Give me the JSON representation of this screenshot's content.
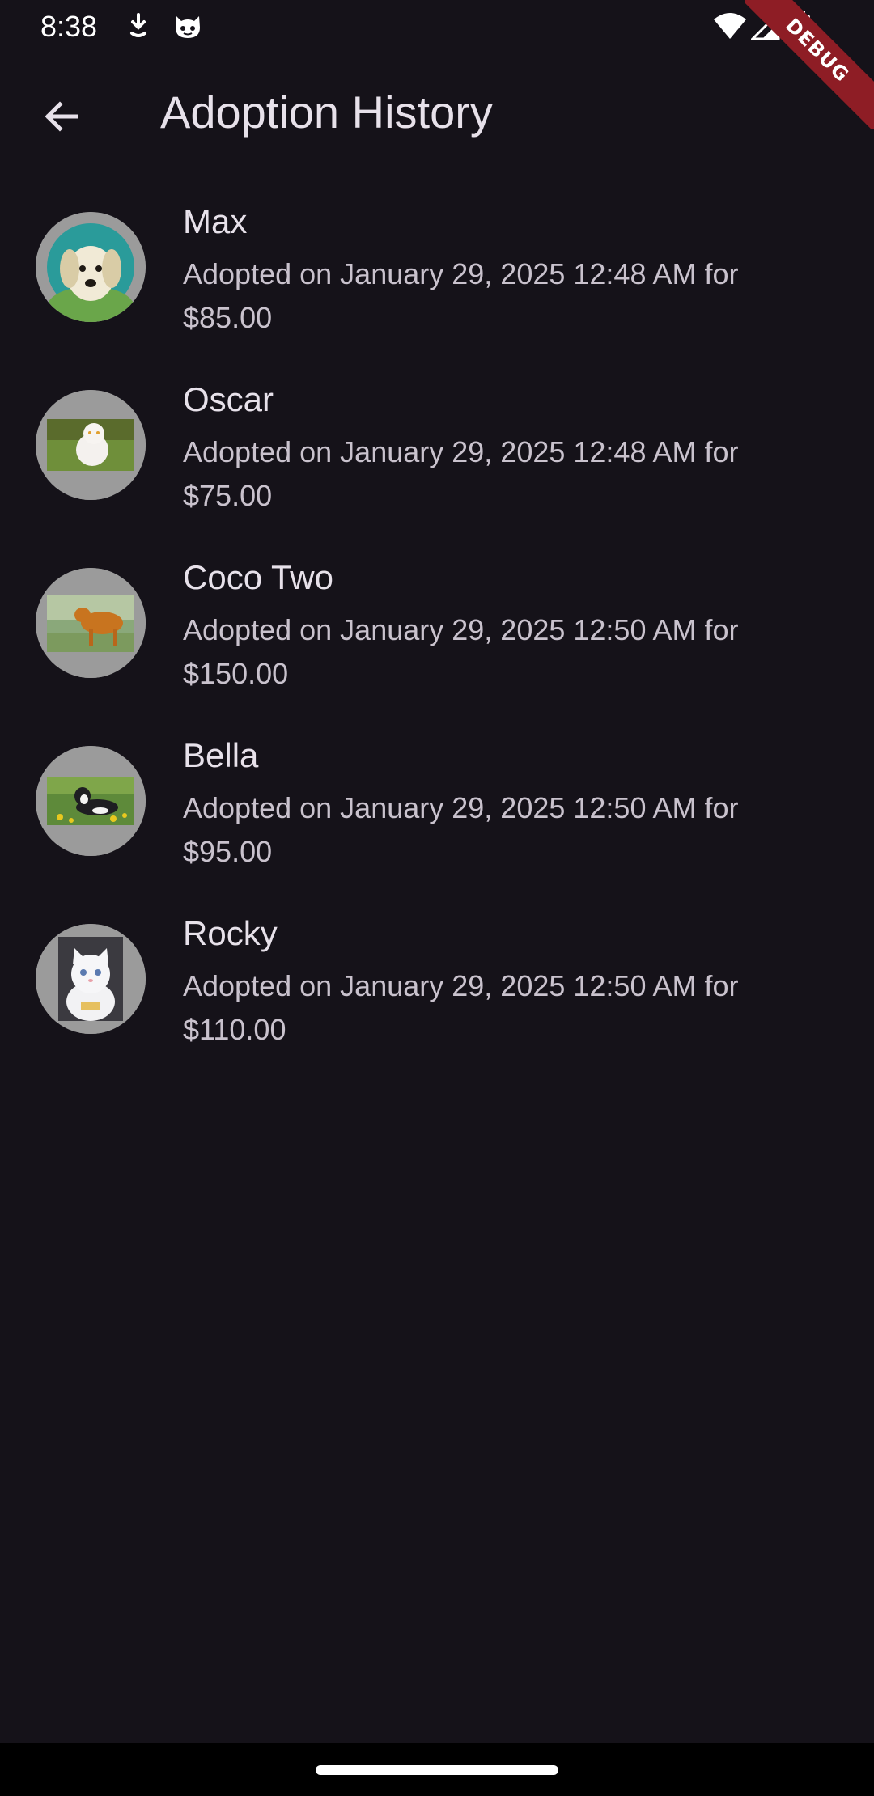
{
  "status_bar": {
    "time": "8:38",
    "icons": [
      "download-icon",
      "cat-face-icon",
      "wifi-icon",
      "signal-icon",
      "battery-icon"
    ]
  },
  "debug_banner": {
    "label": "DEBUG",
    "color": "#8e1d25"
  },
  "app_bar": {
    "back_icon": "arrow-left-icon",
    "title": "Adoption History"
  },
  "adoptions": [
    {
      "name": "Max",
      "detail": "Adopted on January 29, 2025 12:48 AM for $85.00",
      "photo": "puppy-photo"
    },
    {
      "name": "Oscar",
      "detail": "Adopted on January 29, 2025 12:48 AM for $75.00",
      "photo": "white-cat-on-grass-photo"
    },
    {
      "name": "Coco Two",
      "detail": "Adopted on January 29, 2025 12:50 AM for $150.00",
      "photo": "calf-photo"
    },
    {
      "name": "Bella",
      "detail": "Adopted on January 29, 2025 12:50 AM for $95.00",
      "photo": "dog-in-flowers-photo"
    },
    {
      "name": "Rocky",
      "detail": "Adopted on January 29, 2025 12:50 AM for $110.00",
      "photo": "white-kitten-photo"
    }
  ],
  "colors": {
    "background": "#151219",
    "avatar_ring": "#9b9b9b",
    "title_text": "#e7e1ea",
    "detail_text": "#c9c2cd"
  }
}
